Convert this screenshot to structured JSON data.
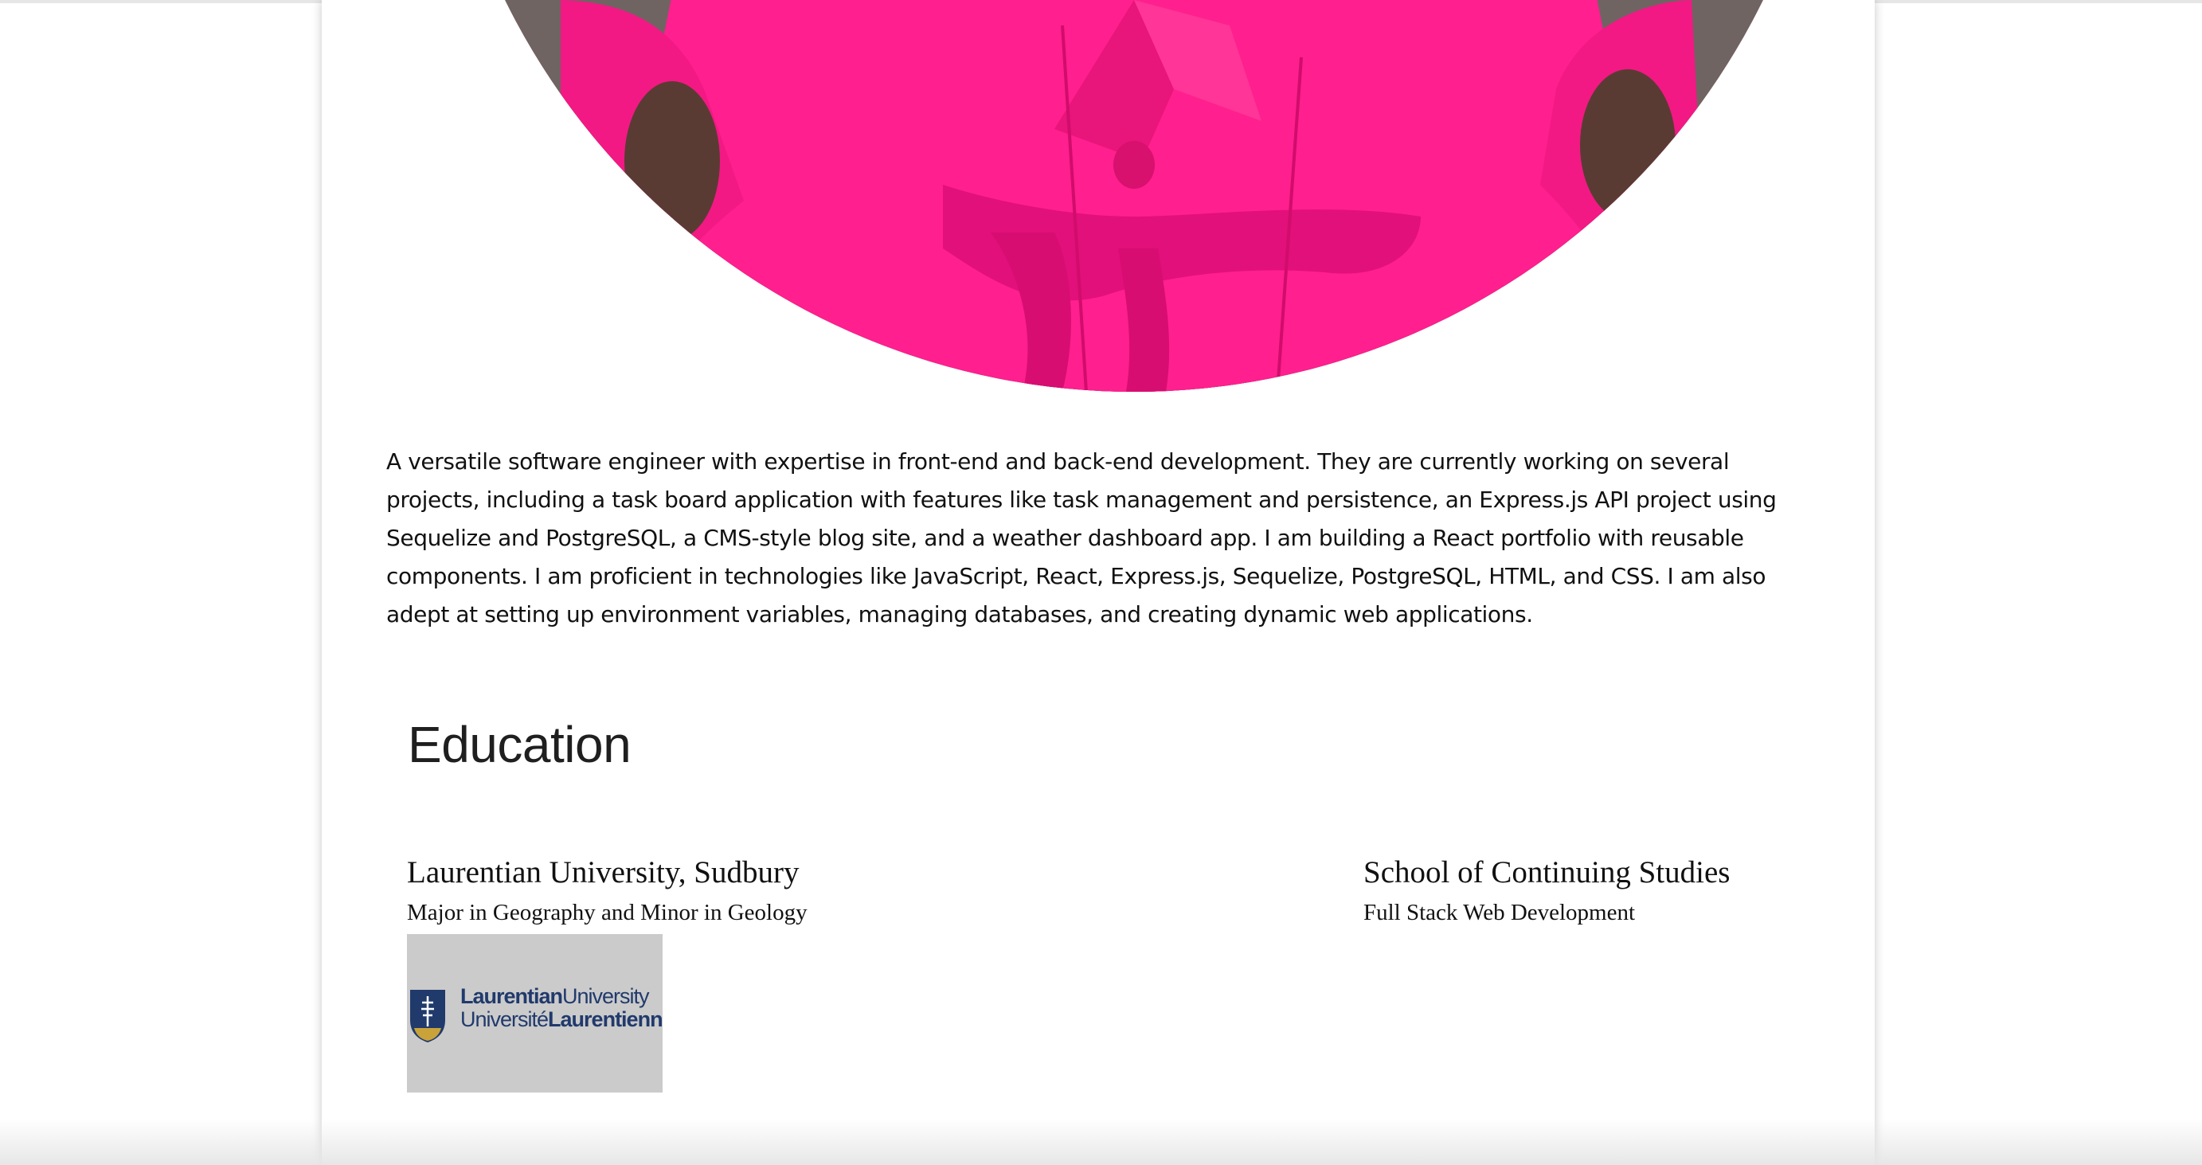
{
  "bio": {
    "text": "A versatile software engineer with expertise in front-end and back-end development. They are currently working on several projects, including a task board application with features like task management and persistence, an Express.js API project using Sequelize and PostgreSQL, a CMS-style blog site, and a weather dashboard app. I am building a React portfolio with reusable components. I am proficient in technologies like JavaScript, React, Express.js, Sequelize, PostgreSQL, HTML, and CSS. I am also adept at setting up environment variables, managing databases, and creating dynamic web applications."
  },
  "education": {
    "heading": "Education",
    "schools": [
      {
        "name": "Laurentian University, Sudbury",
        "program": "Major in Geography and Minor in Geology",
        "logo": {
          "line1_bold": "Laurentian",
          "line1_light": "University",
          "line2_light": "Université",
          "line2_bold": "Laurentienne"
        }
      },
      {
        "name": "School of Continuing Studies",
        "program": "Full Stack Web Development"
      }
    ]
  },
  "colors": {
    "photo_accent": "#ff1f8e",
    "logo_navy": "#213a6c",
    "logo_gold": "#c9a23a",
    "logo_bg": "#cbcbcb"
  }
}
